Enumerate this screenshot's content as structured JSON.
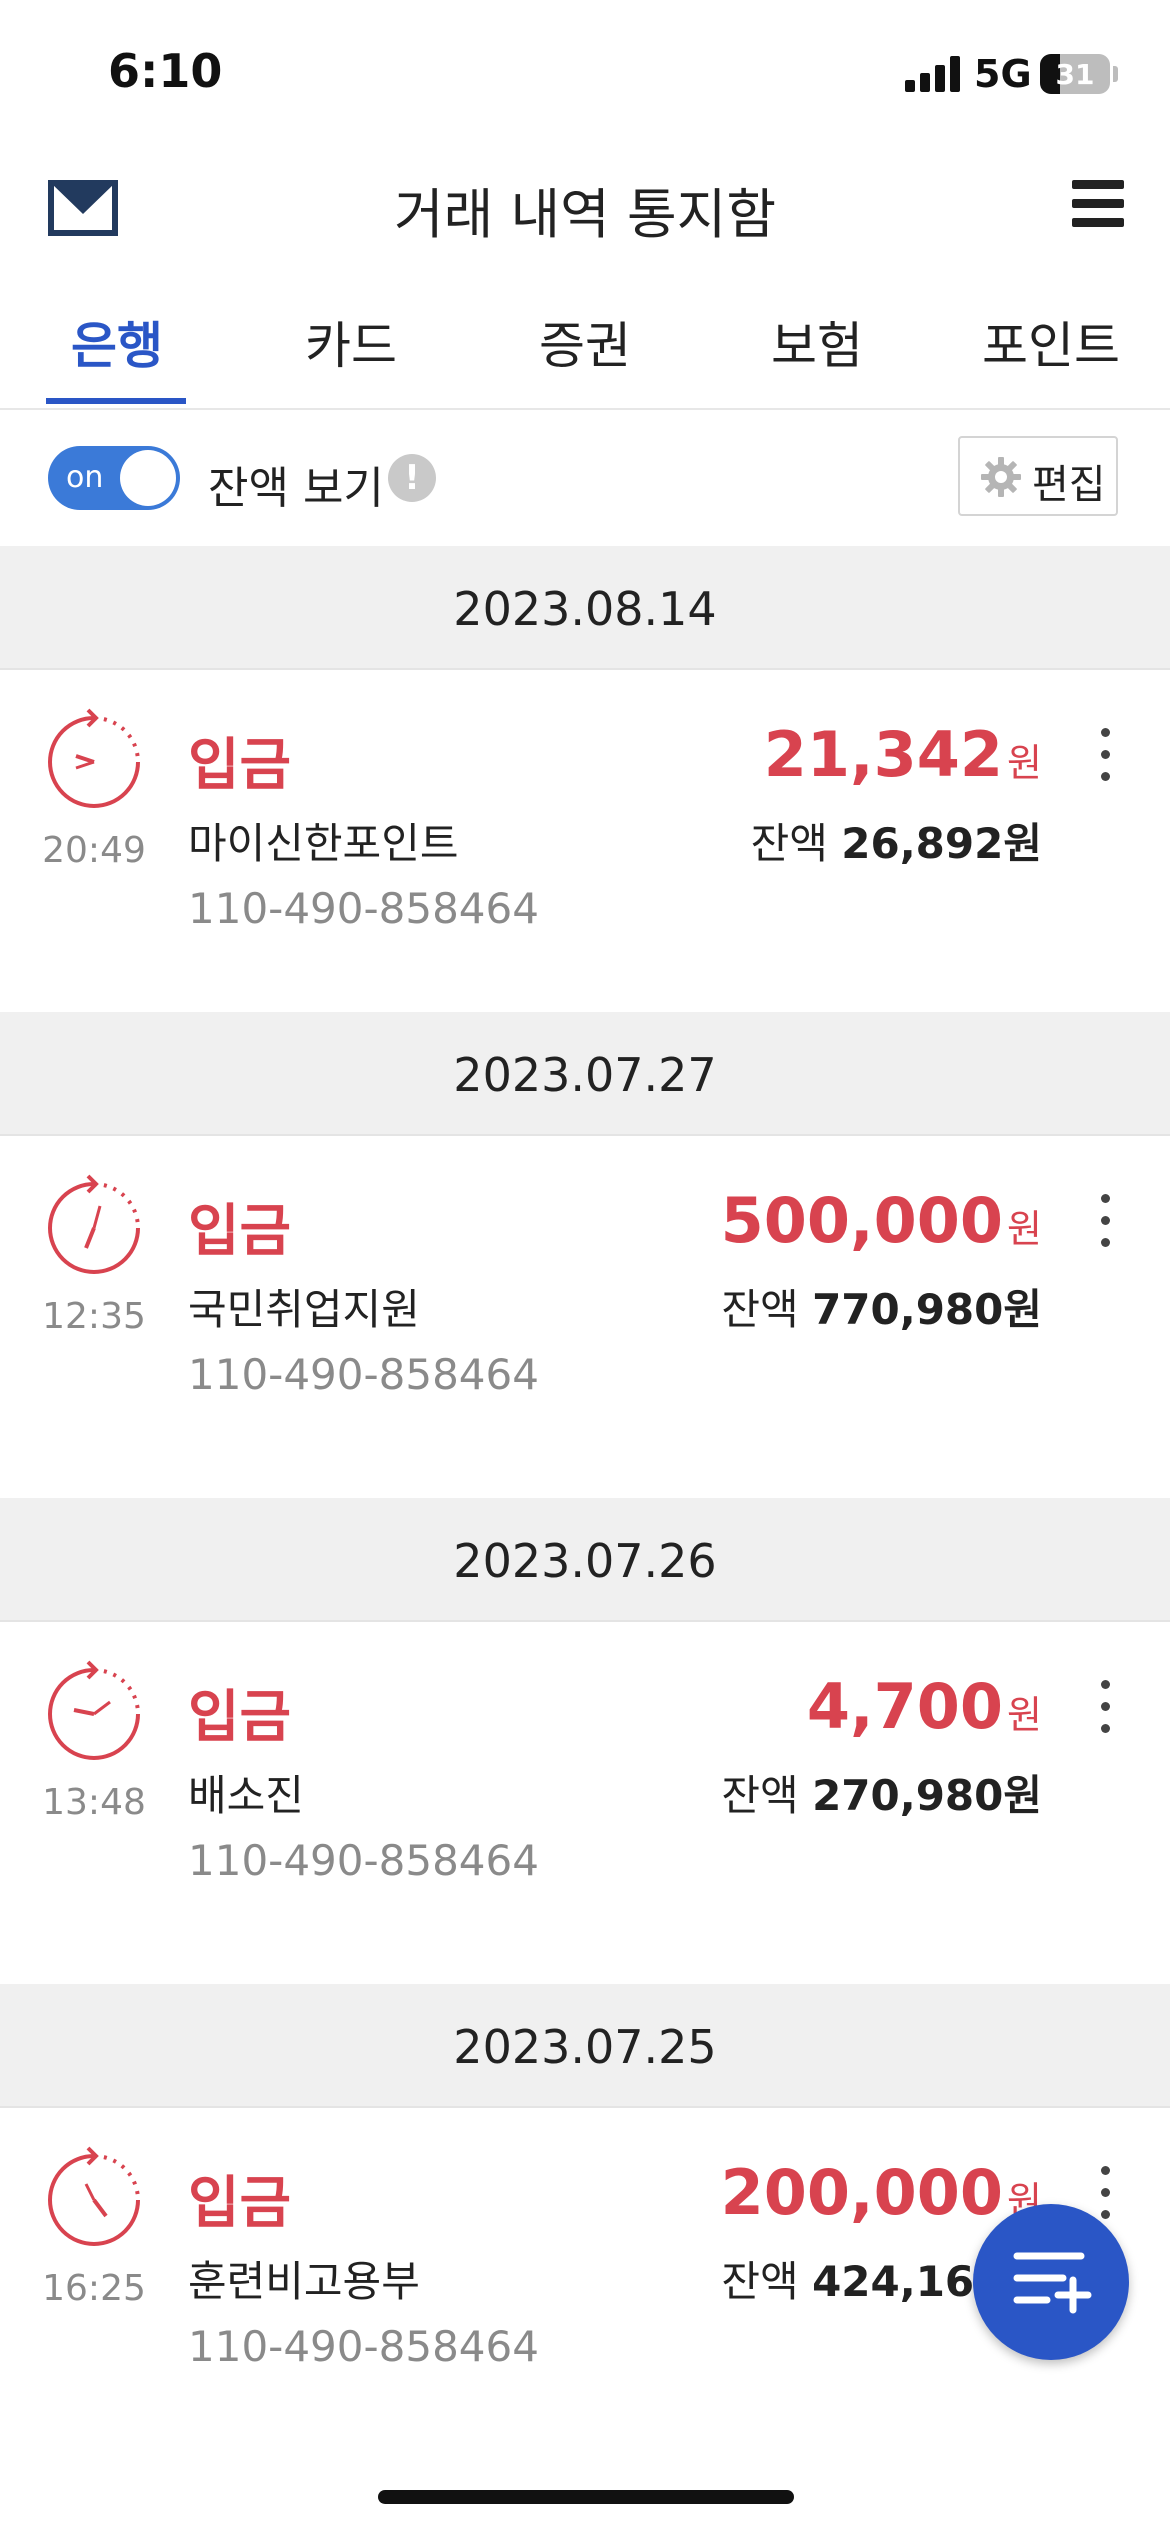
{
  "status_bar": {
    "time": "6:10",
    "network": "5G",
    "battery": "31"
  },
  "header": {
    "title": "거래 내역 통지함",
    "mail_icon": "mail-icon",
    "menu_icon": "hamburger-menu-icon"
  },
  "tabs": [
    {
      "label": "은행",
      "active": true
    },
    {
      "label": "카드",
      "active": false
    },
    {
      "label": "증권",
      "active": false
    },
    {
      "label": "보험",
      "active": false
    },
    {
      "label": "포인트",
      "active": false
    }
  ],
  "balance_toggle": {
    "state": "on",
    "label": "잔액 보기",
    "info_icon": "!",
    "edit_label": "편집"
  },
  "colors": {
    "accent": "#2a56c6",
    "deposit": "#d8434f",
    "toggle": "#3b7ad8"
  },
  "groups": [
    {
      "date": "2023.08.14",
      "transaction": {
        "time": "20:49",
        "type": "입금",
        "description": "마이신한포인트",
        "account": "110-490-858464",
        "amount": "21,342",
        "amount_unit": "원",
        "balance_label": "잔액",
        "balance": "26,892원"
      }
    },
    {
      "date": "2023.07.27",
      "transaction": {
        "time": "12:35",
        "type": "입금",
        "description": "국민취업지원",
        "account": "110-490-858464",
        "amount": "500,000",
        "amount_unit": "원",
        "balance_label": "잔액",
        "balance": "770,980원"
      }
    },
    {
      "date": "2023.07.26",
      "transaction": {
        "time": "13:48",
        "type": "입금",
        "description": "배소진",
        "account": "110-490-858464",
        "amount": "4,700",
        "amount_unit": "원",
        "balance_label": "잔액",
        "balance": "270,980원"
      }
    },
    {
      "date": "2023.07.25",
      "transaction": {
        "time": "16:25",
        "type": "입금",
        "description": "훈련비고용부",
        "account": "110-490-858464",
        "amount": "200,000",
        "amount_unit": "원",
        "balance_label": "잔액",
        "balance": "424,164원"
      }
    }
  ],
  "fab": {
    "icon": "add-list-icon"
  }
}
